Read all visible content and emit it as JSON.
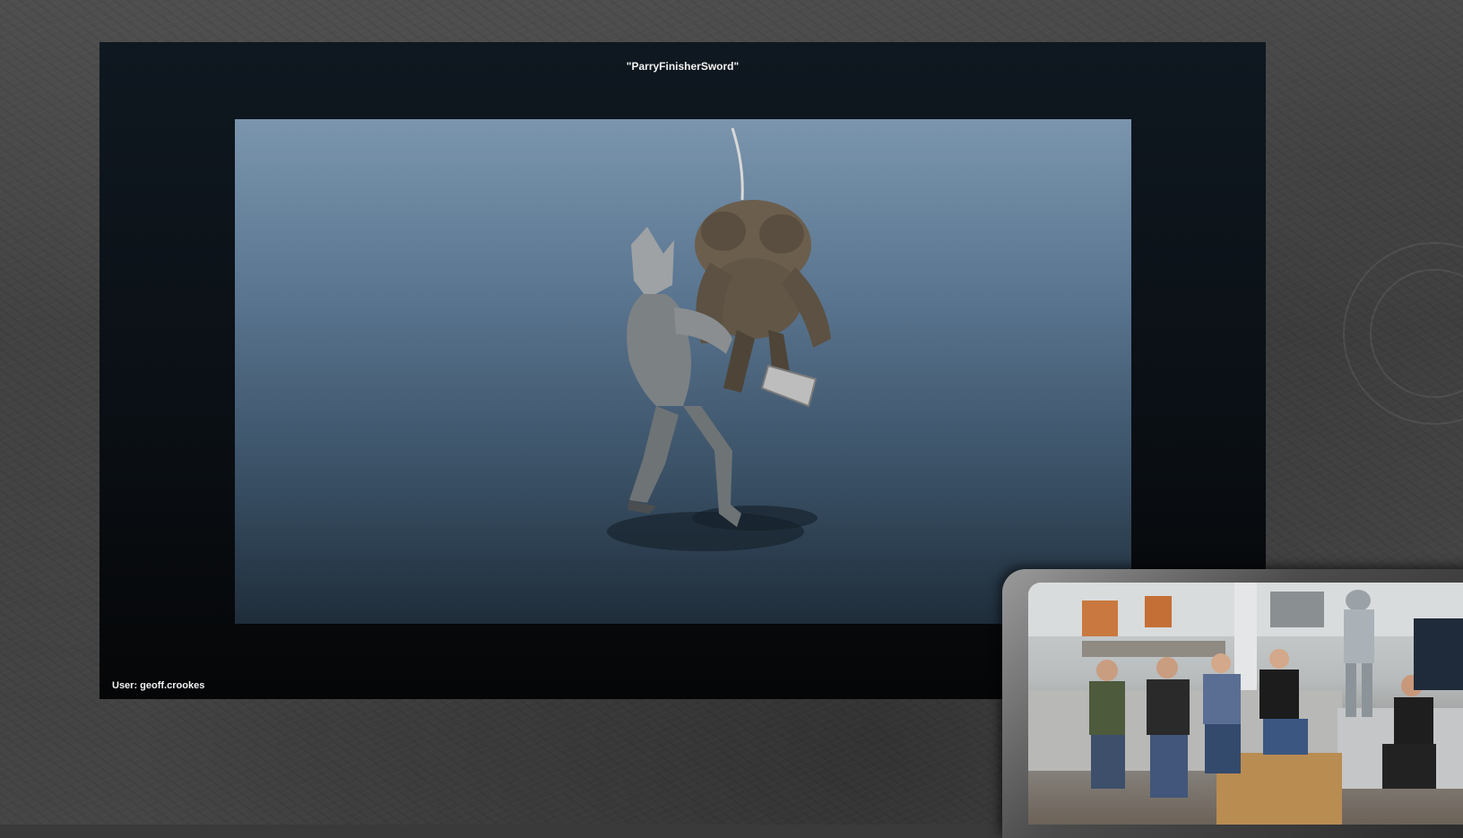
{
  "stream": {
    "animation_name": "\"ParryFinisherSword\"",
    "user_label": "User: geoff.crookes"
  },
  "webcam": {
    "description_icon": "webcam-feed-icon"
  },
  "colors": {
    "viewport_top": "#7a95ad",
    "viewport_bottom": "#1f2d3a",
    "screen_bg": "#0a0f14"
  }
}
